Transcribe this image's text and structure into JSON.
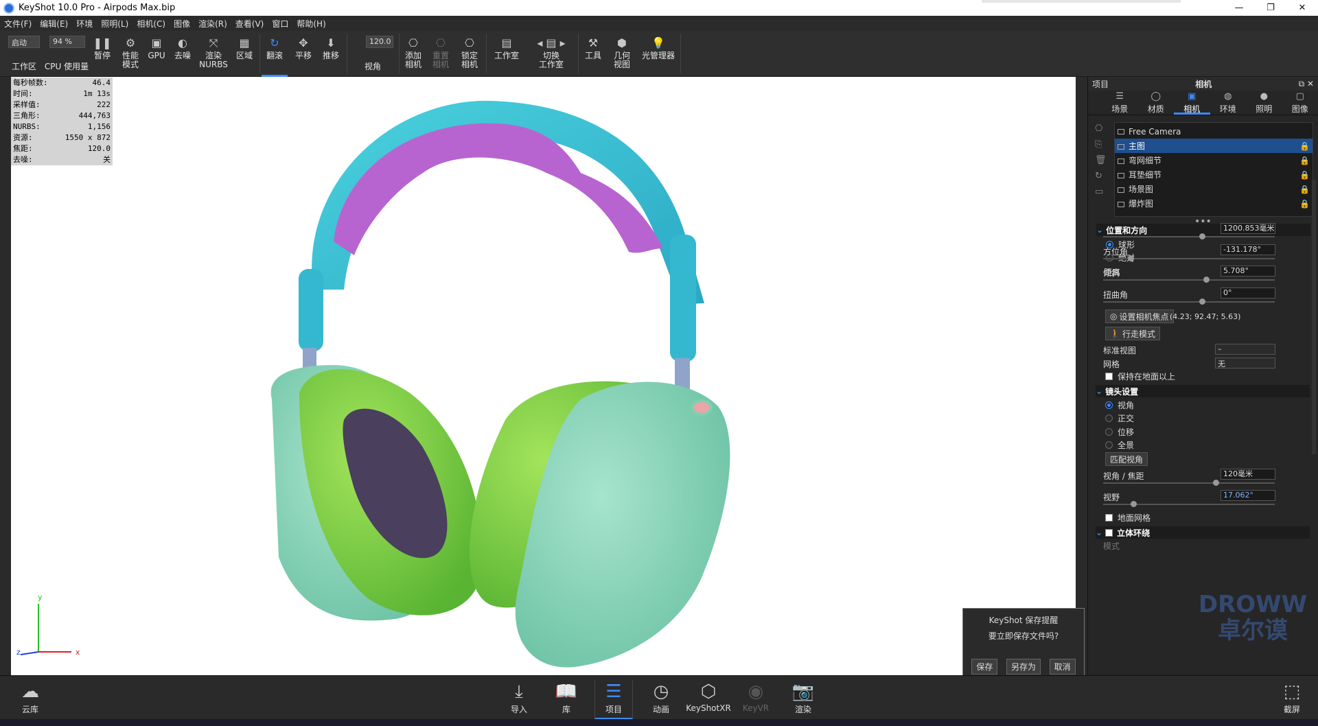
{
  "window": {
    "title": "KeyShot 10.0 Pro  - Airpods Max.bip",
    "buttons": [
      "—",
      "❐",
      "✕"
    ]
  },
  "menu": [
    "文件(F)",
    "编辑(E)",
    "环境",
    "照明(L)",
    "相机(C)",
    "图像",
    "渲染(R)",
    "查看(V)",
    "窗口",
    "帮助(H)"
  ],
  "toolbar": {
    "preset": "启动",
    "cpu_percent": "94 %",
    "focal": "120.0",
    "items": {
      "workspace": "工作区",
      "cpu": "CPU 使用量",
      "pause": "暂停",
      "perf": "性能\n模式",
      "gpu": "GPU",
      "denoise": "去噪",
      "nurbs": "渲染\nNURBS",
      "region": "区域",
      "tumble": "翻滚",
      "pan": "平移",
      "dolly": "推移",
      "fov": "视角",
      "add_cam": "添加\n相机",
      "reset_cam": "重置\n相机",
      "lock_cam": "锁定\n相机",
      "studio": "工作室",
      "switch_studio": "切换\n工作室",
      "tools": "工具",
      "geo_view": "几何\n视图",
      "light_mgr": "光管理器"
    }
  },
  "stats": [
    {
      "k": "每秒帧数:",
      "v": "46.4"
    },
    {
      "k": "时间:",
      "v": "1m 13s"
    },
    {
      "k": "采样值:",
      "v": "222"
    },
    {
      "k": "三角形:",
      "v": "444,763"
    },
    {
      "k": "NURBS:",
      "v": "1,156"
    },
    {
      "k": "资源:",
      "v": "1550 x 872"
    },
    {
      "k": "焦距:",
      "v": "120.0"
    },
    {
      "k": "去噪:",
      "v": "关"
    }
  ],
  "axis": {
    "x": "x",
    "y": "y",
    "z": "z"
  },
  "save_dialog": {
    "title": "KeyShot 保存提醒",
    "message": "要立即保存文件吗?",
    "save": "保存",
    "save_as": "另存为",
    "cancel": "取消"
  },
  "panel": {
    "project_label": "项目",
    "title": "相机",
    "tabs": [
      "场景",
      "材质",
      "相机",
      "环境",
      "照明",
      "图像"
    ],
    "cameras": [
      "Free Camera",
      "主图",
      "弯网细节",
      "耳垫细节",
      "场景图",
      "爆炸图"
    ],
    "sections": {
      "position": "位置和方向",
      "lens": "镜头设置",
      "stereo": "立体环绕"
    },
    "mode_sphere": "球形",
    "mode_absolute": "绝对",
    "distance_label": "距离",
    "distance": "1200.853毫米",
    "azimuth_label": "方位角",
    "azimuth": "-131.178°",
    "incline_label": "倾斜",
    "incline": "5.708°",
    "twist_label": "扭曲角",
    "twist": "0°",
    "set_focus": "设置相机焦点",
    "focus_coords": "(4.23; 92.47; 5.63)",
    "walk_mode": "行走模式",
    "std_view_label": "标准视图",
    "std_view": "–",
    "grid_label": "网格",
    "grid": "无",
    "keep_above": "保持在地面以上",
    "lens_modes": [
      "视角",
      "正交",
      "位移",
      "全景"
    ],
    "match_fov": "匹配视角",
    "fov_focal_label": "视角 / 焦距",
    "fov_focal": "120毫米",
    "fov_label": "视野",
    "fov": "17.062°",
    "ground_grid": "地面网格",
    "stereo_mode": "模式"
  },
  "bottom": {
    "cloud": "云库",
    "import": "导入",
    "library": "库",
    "project": "项目",
    "animation": "动画",
    "keyshotxr": "KeyShotXR",
    "keyvr": "KeyVR",
    "render": "渲染",
    "screenshot": "截屏"
  },
  "watermark": "DROWW\n卓尔谟",
  "colors": {
    "accent": "#3d8bff",
    "band": "#3ec5d6",
    "band_inner": "#c069d6",
    "cushion": "#7fd444",
    "cup": "#8fd8bd"
  },
  "icons": [
    "app-logo-icon",
    "pause-icon",
    "gear-icon",
    "tumble-icon",
    "camera-icon",
    "cloud-icon",
    "book-icon",
    "list-icon",
    "clock-icon",
    "cube-icon",
    "vr-icon",
    "screenshot-icon"
  ]
}
